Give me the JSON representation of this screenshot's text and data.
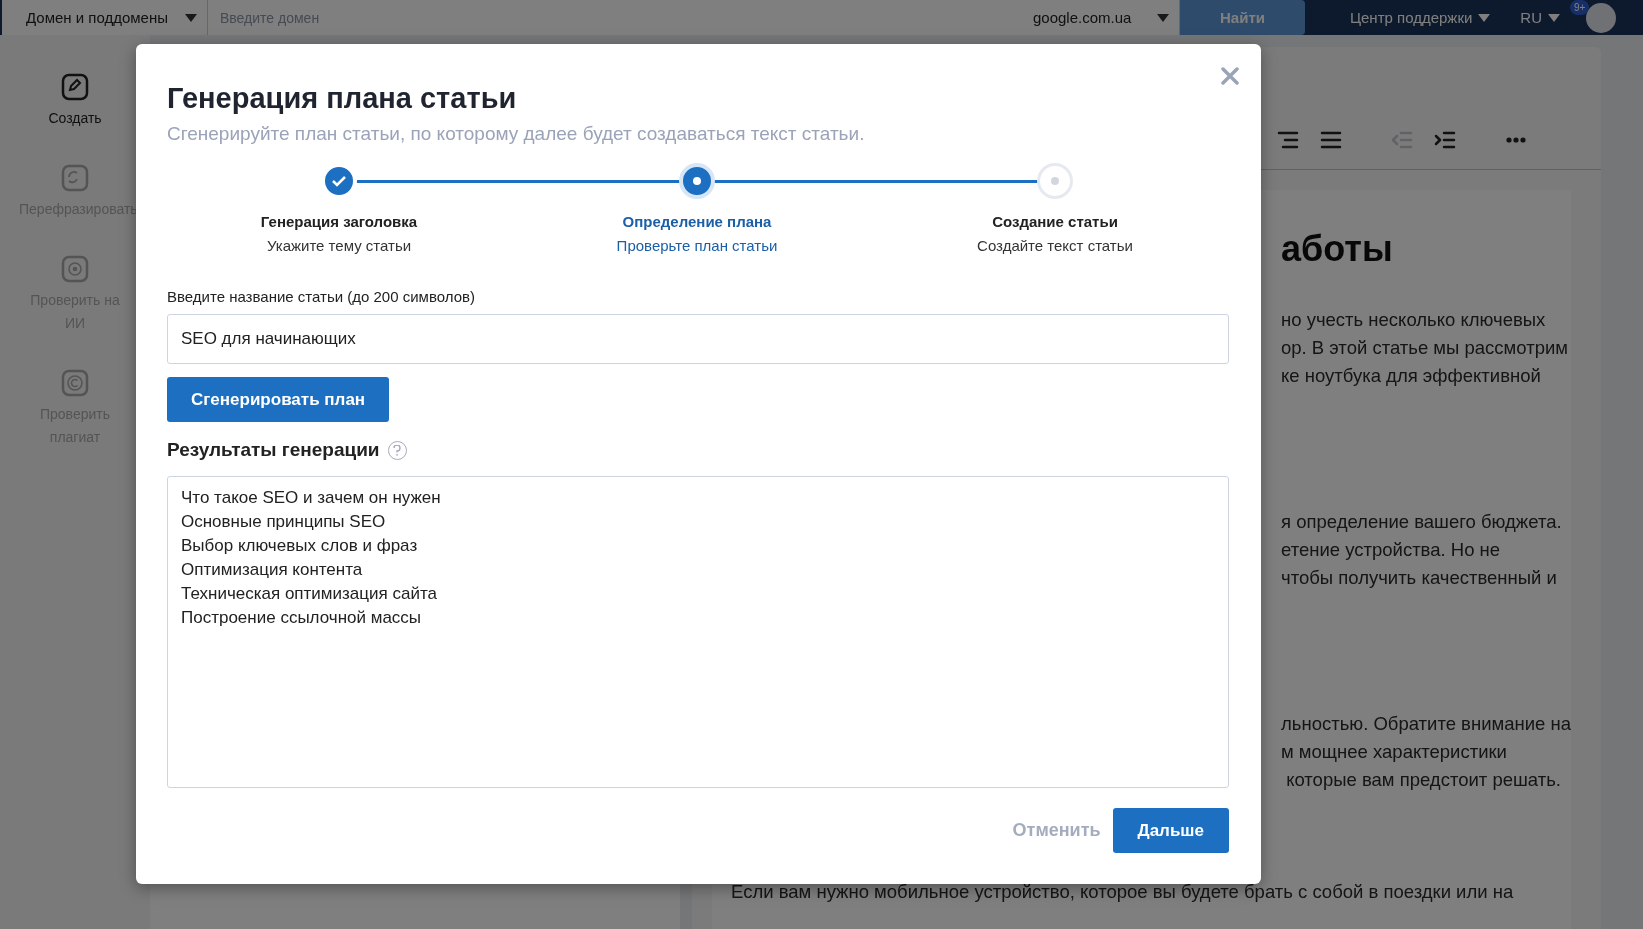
{
  "topbar": {
    "scope_select": "Домен и поддомены",
    "domain_field": {
      "placeholder": "Введите домен"
    },
    "engine_select": "google.com.ua",
    "search_button": {
      "label": "Найти",
      "disabled": true
    },
    "support_menu": "Центр поддержки",
    "language_menu": "RU",
    "notifications_badge": "9+"
  },
  "sidebar": {
    "items": [
      {
        "kind": "create",
        "label": "Создать",
        "selected": true
      },
      {
        "kind": "rephrase",
        "label": "Перефразировать",
        "selected": false
      },
      {
        "kind": "ai-check",
        "label": "Проверить на ИИ",
        "selected": false
      },
      {
        "kind": "plagiarism",
        "label": "Проверить плагиат",
        "selected": false
      }
    ]
  },
  "editor": {
    "toolbar": [
      {
        "kind": "align-right",
        "disabled": false
      },
      {
        "kind": "justify",
        "disabled": false
      },
      {
        "kind": "outdent",
        "disabled": true
      },
      {
        "kind": "indent",
        "disabled": false
      },
      {
        "kind": "more",
        "disabled": false
      }
    ],
    "heading": "аботы",
    "paragraphs": [
      {
        "kind": "clipped",
        "lines": [
          "но учесть несколько ключевых",
          "ор. В этой статье мы рассмотрим",
          "ке ноутбука для эффективной"
        ]
      },
      {
        "kind": "clipped",
        "lines": [
          "я определение вашего бюджета.",
          "етение устройства. Но не",
          "чтобы получить качественный и"
        ]
      },
      {
        "kind": "clipped",
        "lines": [
          "льностью. Обратите внимание на",
          "м мощнее характеристики",
          " которые вам предстоит решать."
        ]
      },
      {
        "kind": "full",
        "lines": [
          "Если вам нужно мобильное устройство, которое вы будете брать с собой в поездки или на"
        ]
      }
    ]
  },
  "modal": {
    "title": "Генерация плана статьи",
    "subtitle": "Сгенерируйте план статьи, по которому далее будет создаваться текст статьи.",
    "steps": [
      {
        "kind": "done",
        "title": "Генерация заголовка",
        "hint": "Укажите тему статьи"
      },
      {
        "kind": "current",
        "title": "Определение плана",
        "hint": "Проверьте план статьи"
      },
      {
        "kind": "pending",
        "title": "Создание статьи",
        "hint": "Создайте текст статьи"
      }
    ],
    "title_field": {
      "label": "Введите название статьи (до 200 символов)",
      "value": "SEO для начинающих"
    },
    "generate_button": "Сгенерировать план",
    "results": {
      "label": "Результаты генерации",
      "lines": [
        "Что такое SEO и зачем он нужен",
        "Основные принципы SEO",
        "Выбор ключевых слов и фраз",
        "Оптимизация контента",
        "Техническая оптимизация сайта",
        "Построение ссылочной массы"
      ]
    },
    "cancel_button": "Отменить",
    "next_button": "Дальше"
  }
}
